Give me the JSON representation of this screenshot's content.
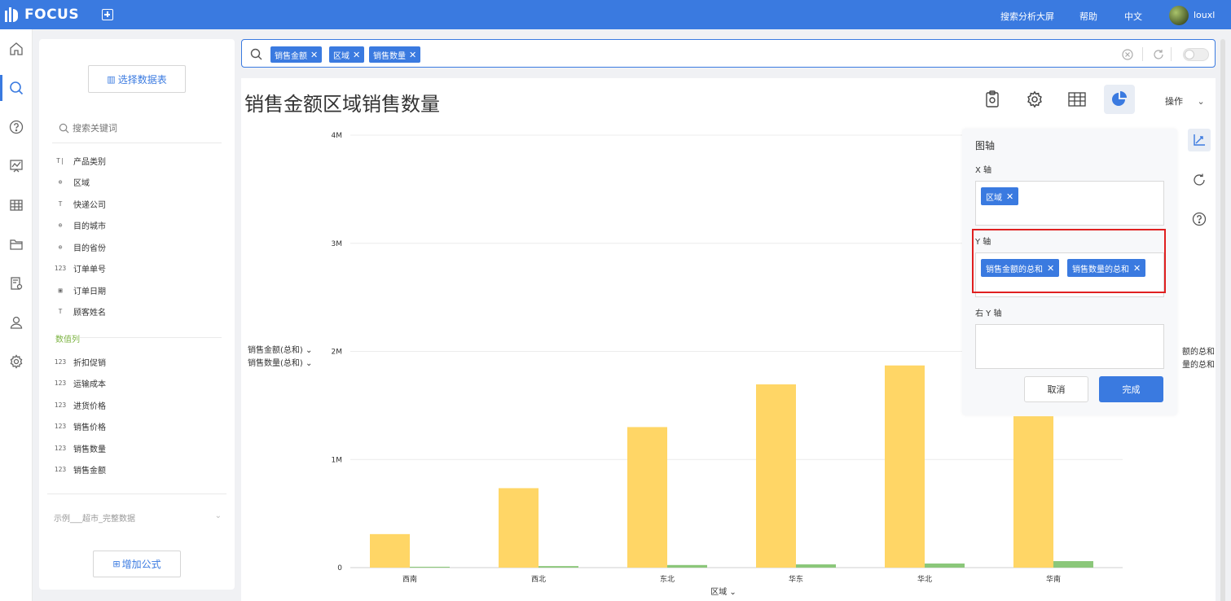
{
  "app": {
    "logo": "FOCUS"
  },
  "topbar": {
    "bigscreen": "搜索分析大屏",
    "help": "帮助",
    "lang": "中文",
    "user": "louxl"
  },
  "datapanel": {
    "select_table": "选择数据表",
    "search_placeholder": "搜索关键词",
    "dimension_cols": [
      {
        "icon": "T|",
        "label": "产品类别"
      },
      {
        "icon": "globe",
        "label": "区域"
      },
      {
        "icon": "T",
        "label": "快递公司"
      },
      {
        "icon": "globe",
        "label": "目的城市"
      },
      {
        "icon": "globe",
        "label": "目的省份"
      },
      {
        "icon": "123",
        "label": "订单单号"
      },
      {
        "icon": "calendar",
        "label": "订单日期"
      },
      {
        "icon": "T",
        "label": "顾客姓名"
      }
    ],
    "measure_section": "数值列",
    "measure_cols": [
      {
        "icon": "123",
        "label": "折扣促销"
      },
      {
        "icon": "123",
        "label": "运输成本"
      },
      {
        "icon": "123",
        "label": "进货价格"
      },
      {
        "icon": "123",
        "label": "销售价格"
      },
      {
        "icon": "123",
        "label": "销售数量"
      },
      {
        "icon": "123",
        "label": "销售金额"
      }
    ],
    "datasource": "示例___超市_完整数据",
    "add_formula": "增加公式"
  },
  "search": {
    "chips": [
      "销售金额",
      "区域",
      "销售数量"
    ]
  },
  "main": {
    "title": "销售金额区域销售数量",
    "ops_label": "操作"
  },
  "chart_data": {
    "type": "bar",
    "categories": [
      "西南",
      "西北",
      "东北",
      "华东",
      "华北",
      "华南"
    ],
    "series": [
      {
        "name": "销售金额(总和)",
        "values": [
          310000,
          735000,
          1300000,
          1695000,
          1870000,
          1400000
        ],
        "color": "#ffd666"
      },
      {
        "name": "销售数量(总和)",
        "values": [
          8000,
          14000,
          24000,
          30000,
          38000,
          60000
        ],
        "color": "#8bc77a"
      }
    ],
    "xlabel": "区域",
    "ylim": [
      0,
      4000000
    ],
    "yticks": [
      "0",
      "1M",
      "2M",
      "3M",
      "4M"
    ],
    "grid": true,
    "legend_right": [
      "额的总和",
      "量的总和"
    ]
  },
  "axis_panel": {
    "title": "图轴",
    "x_label": "X 轴",
    "x_chips": [
      "区域"
    ],
    "y_label": "Y 轴",
    "y_chips": [
      "销售金额的总和",
      "销售数量的总和"
    ],
    "right_y_label": "右 Y 轴",
    "cancel": "取消",
    "done": "完成"
  },
  "colors": {
    "accent": "#3a7ae0",
    "highlight": "#e02020"
  }
}
